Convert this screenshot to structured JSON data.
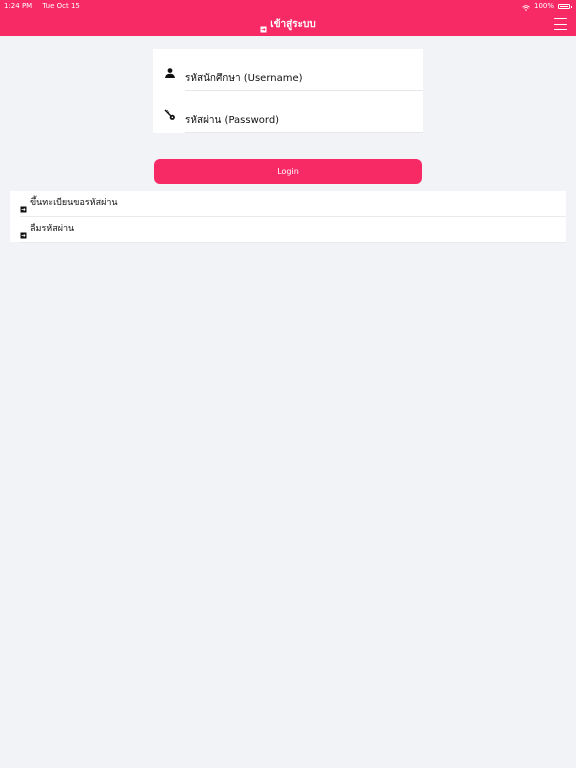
{
  "status_bar": {
    "time": "1:24 PM",
    "date": "Tue Oct 15",
    "battery_text": "100%"
  },
  "header": {
    "title": "เข้าสู่ระบบ",
    "title_icon": "login-icon",
    "menu_icon": "menu-icon"
  },
  "form": {
    "username_placeholder": "รหัสนักศึกษา (Username)",
    "password_placeholder": "รหัสผ่าน (Password)",
    "username_icon": "user-icon",
    "password_icon": "key-icon"
  },
  "actions": {
    "login_label": "Login"
  },
  "links": [
    {
      "label": "ขึ้นทะเบียนขอรหัสผ่าน",
      "icon": "login-icon"
    },
    {
      "label": "ลืมรหัสผ่าน",
      "icon": "login-icon"
    }
  ],
  "colors": {
    "primary": "#f82a66",
    "background": "#f2f3f7",
    "surface": "#ffffff"
  }
}
